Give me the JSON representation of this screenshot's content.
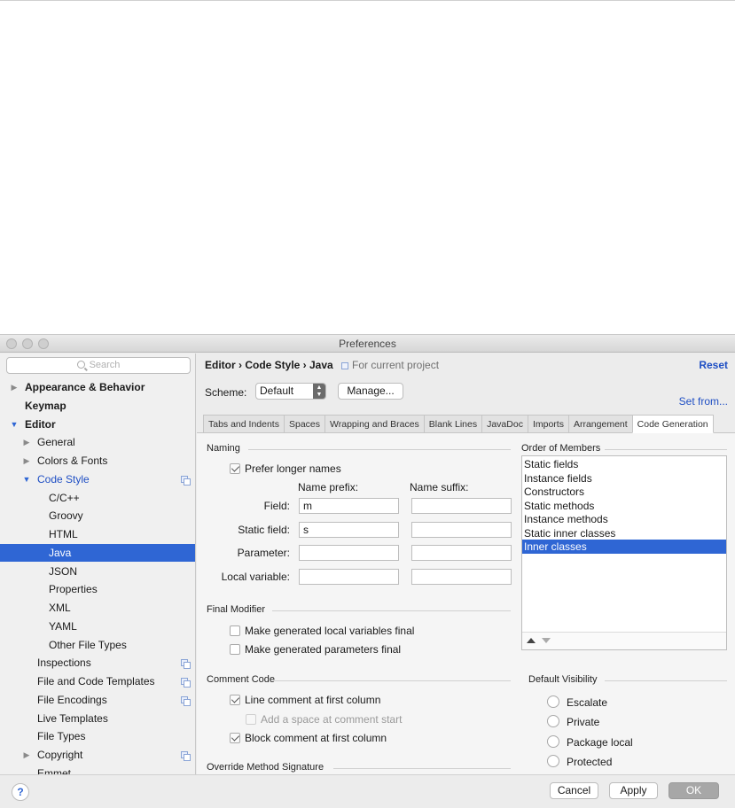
{
  "window": {
    "title": "Preferences"
  },
  "sidebar": {
    "search_placeholder": "Search",
    "items": [
      {
        "label": "Appearance & Behavior",
        "level": 0,
        "bold": true,
        "arrow": "closed"
      },
      {
        "label": "Keymap",
        "level": 0,
        "bold": true,
        "arrow": "none"
      },
      {
        "label": "Editor",
        "level": 0,
        "bold": true,
        "arrow": "open"
      },
      {
        "label": "General",
        "level": 1,
        "arrow": "closed"
      },
      {
        "label": "Colors & Fonts",
        "level": 1,
        "arrow": "closed"
      },
      {
        "label": "Code Style",
        "level": 1,
        "arrow": "open",
        "active": true,
        "copy_icon": true
      },
      {
        "label": "C/C++",
        "level": 2
      },
      {
        "label": "Groovy",
        "level": 2
      },
      {
        "label": "HTML",
        "level": 2
      },
      {
        "label": "Java",
        "level": 2,
        "selected": true
      },
      {
        "label": "JSON",
        "level": 2
      },
      {
        "label": "Properties",
        "level": 2
      },
      {
        "label": "XML",
        "level": 2
      },
      {
        "label": "YAML",
        "level": 2
      },
      {
        "label": "Other File Types",
        "level": 2
      },
      {
        "label": "Inspections",
        "level": 1,
        "copy_icon": true
      },
      {
        "label": "File and Code Templates",
        "level": 1,
        "copy_icon": true
      },
      {
        "label": "File Encodings",
        "level": 1,
        "copy_icon": true
      },
      {
        "label": "Live Templates",
        "level": 1
      },
      {
        "label": "File Types",
        "level": 1
      },
      {
        "label": "Copyright",
        "level": 1,
        "arrow": "closed",
        "copy_icon": true
      },
      {
        "label": "Emmet",
        "level": 1
      }
    ]
  },
  "header": {
    "breadcrumb": "Editor › Code Style › Java",
    "project_note": "For current project",
    "reset": "Reset",
    "scheme_label": "Scheme:",
    "scheme_value": "Default",
    "manage": "Manage...",
    "set_from": "Set from..."
  },
  "tabs": [
    {
      "label": "Tabs and Indents"
    },
    {
      "label": "Spaces"
    },
    {
      "label": "Wrapping and Braces"
    },
    {
      "label": "Blank Lines"
    },
    {
      "label": "JavaDoc"
    },
    {
      "label": "Imports"
    },
    {
      "label": "Arrangement"
    },
    {
      "label": "Code Generation",
      "active": true
    }
  ],
  "naming": {
    "title": "Naming",
    "prefer_longer": "Prefer longer names",
    "prefix_header": "Name prefix:",
    "suffix_header": "Name suffix:",
    "rows": [
      {
        "label": "Field:",
        "prefix": "m",
        "suffix": ""
      },
      {
        "label": "Static field:",
        "prefix": "s",
        "suffix": ""
      },
      {
        "label": "Parameter:",
        "prefix": "",
        "suffix": ""
      },
      {
        "label": "Local variable:",
        "prefix": "",
        "suffix": ""
      }
    ]
  },
  "final_modifier": {
    "title": "Final Modifier",
    "local_vars": "Make generated local variables final",
    "params": "Make generated parameters final"
  },
  "comment_code": {
    "title": "Comment Code",
    "line_comment": "Line comment at first column",
    "add_space": "Add a space at comment start",
    "block_comment": "Block comment at first column"
  },
  "override": {
    "title": "Override Method Signature"
  },
  "order_of_members": {
    "title": "Order of Members",
    "items": [
      "Static fields",
      "Instance fields",
      "Constructors",
      "Static methods",
      "Instance methods",
      "Static inner classes",
      "Inner classes"
    ],
    "selected_index": 6
  },
  "default_visibility": {
    "title": "Default Visibility",
    "options": [
      "Escalate",
      "Private",
      "Package local",
      "Protected"
    ]
  },
  "footer": {
    "help": "?",
    "cancel": "Cancel",
    "apply": "Apply",
    "ok": "OK"
  },
  "colors": {
    "selection": "#2f66d4",
    "link": "#1f4fc4"
  }
}
